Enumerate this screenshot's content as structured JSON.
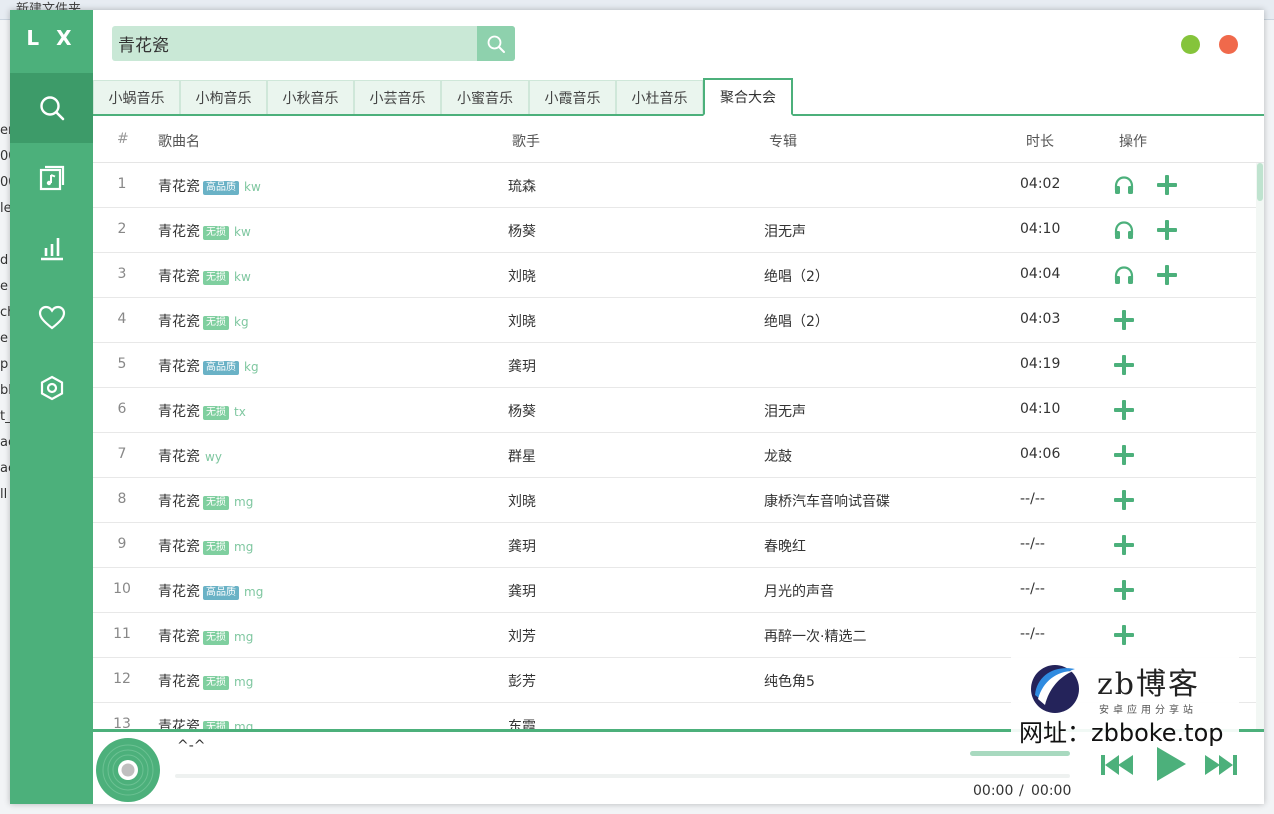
{
  "desktop": {
    "title": "新建文件夹",
    "fragments": [
      "er",
      "00",
      "00",
      "le",
      "",
      "d",
      "e",
      "ch",
      "e",
      "p",
      "bl",
      "t_",
      "ac",
      "ac",
      "ll"
    ]
  },
  "app": {
    "logo": "L X"
  },
  "sidebar": {
    "items": [
      {
        "icon": "search-icon",
        "active": true
      },
      {
        "icon": "music-list-icon",
        "active": false
      },
      {
        "icon": "leaderboard-icon",
        "active": false
      },
      {
        "icon": "heart-icon",
        "active": false
      },
      {
        "icon": "settings-icon",
        "active": false
      }
    ]
  },
  "search": {
    "value": "青花瓷",
    "placeholder": ""
  },
  "window_controls": {
    "minimize_color": "#85c43b",
    "close_color": "#f0694b"
  },
  "tabs": [
    {
      "label": "小蜗音乐"
    },
    {
      "label": "小枸音乐"
    },
    {
      "label": "小秋音乐"
    },
    {
      "label": "小芸音乐"
    },
    {
      "label": "小蜜音乐"
    },
    {
      "label": "小霞音乐"
    },
    {
      "label": "小杜音乐"
    },
    {
      "label": "聚合大会",
      "active": true
    }
  ],
  "table": {
    "headers": {
      "num": "#",
      "name": "歌曲名",
      "singer": "歌手",
      "album": "专辑",
      "duration": "时长",
      "ops": "操作"
    },
    "rows": [
      {
        "num": "1",
        "name": "青花瓷",
        "badge": "高品质",
        "source": "kw",
        "singer": "琉森",
        "album": "",
        "duration": "04:02",
        "ops": [
          "listen",
          "add"
        ]
      },
      {
        "num": "2",
        "name": "青花瓷",
        "badge": "无损",
        "source": "kw",
        "singer": "杨葵",
        "album": "泪无声",
        "duration": "04:10",
        "ops": [
          "listen",
          "add"
        ]
      },
      {
        "num": "3",
        "name": "青花瓷",
        "badge": "无损",
        "source": "kw",
        "singer": "刘晓",
        "album": "绝唱（2）",
        "duration": "04:04",
        "ops": [
          "listen",
          "add"
        ]
      },
      {
        "num": "4",
        "name": "青花瓷",
        "badge": "无损",
        "source": "kg",
        "singer": "刘晓",
        "album": "绝唱（2）",
        "duration": "04:03",
        "ops": [
          "add"
        ]
      },
      {
        "num": "5",
        "name": "青花瓷",
        "badge": "高品质",
        "source": "kg",
        "singer": "龚玥",
        "album": "",
        "duration": "04:19",
        "ops": [
          "add"
        ]
      },
      {
        "num": "6",
        "name": "青花瓷",
        "badge": "无损",
        "source": "tx",
        "singer": "杨葵",
        "album": "泪无声",
        "duration": "04:10",
        "ops": [
          "add"
        ]
      },
      {
        "num": "7",
        "name": "青花瓷",
        "badge": "",
        "source": "wy",
        "singer": "群星",
        "album": "龙鼓",
        "duration": "04:06",
        "ops": [
          "add"
        ]
      },
      {
        "num": "8",
        "name": "青花瓷",
        "badge": "无损",
        "source": "mg",
        "singer": "刘晓",
        "album": "康桥汽车音响试音碟",
        "duration": "--/--",
        "ops": [
          "add"
        ]
      },
      {
        "num": "9",
        "name": "青花瓷",
        "badge": "无损",
        "source": "mg",
        "singer": "龚玥",
        "album": "春晚红",
        "duration": "--/--",
        "ops": [
          "add"
        ]
      },
      {
        "num": "10",
        "name": "青花瓷",
        "badge": "高品质",
        "source": "mg",
        "singer": "龚玥",
        "album": "月光的声音",
        "duration": "--/--",
        "ops": [
          "add"
        ]
      },
      {
        "num": "11",
        "name": "青花瓷",
        "badge": "无损",
        "source": "mg",
        "singer": "刘芳",
        "album": "再醉一次·精选二",
        "duration": "--/--",
        "ops": [
          "add"
        ]
      },
      {
        "num": "12",
        "name": "青花瓷",
        "badge": "无损",
        "source": "mg",
        "singer": "彭芳",
        "album": "纯色角5",
        "duration": "",
        "ops": []
      },
      {
        "num": "13",
        "name": "青花瓷",
        "badge": "无损",
        "source": "mg",
        "singer": "东霞",
        "album": "",
        "duration": "",
        "ops": []
      }
    ]
  },
  "player": {
    "title": "^-^",
    "current_time": "00:00",
    "separator": "/",
    "total_time": "00:00",
    "progress": 0
  },
  "watermark": {
    "name": "zb博客",
    "sub": "安卓应用分享站",
    "url": "网址：zbboke.top"
  },
  "colors": {
    "accent": "#4cb07b",
    "accent_dark": "#3d9b69",
    "badge_hq": "#6ab2c6",
    "badge_lossless": "#7fcf9f"
  }
}
